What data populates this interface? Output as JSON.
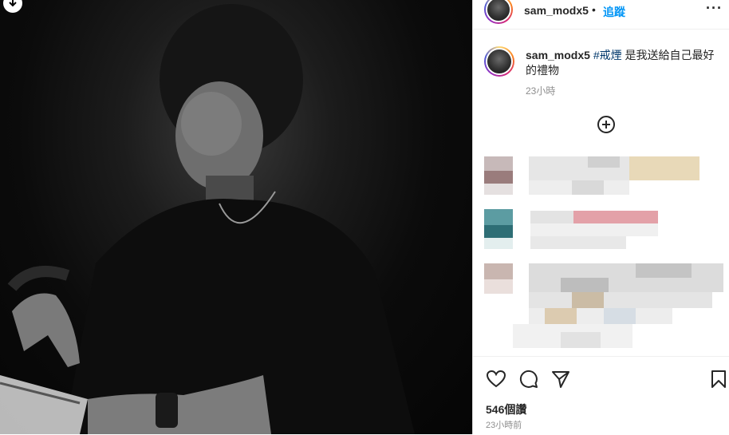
{
  "header": {
    "username": "sam_modx5",
    "separator": "•",
    "follow_label": "追蹤",
    "more_label": "···"
  },
  "post": {
    "caption_user": "sam_modx5",
    "hashtag": "#戒煙",
    "caption_text": " 是我送給自己最好的禮物",
    "age": "23小時"
  },
  "footer": {
    "likes": "546個讚",
    "posted_ago": "23小時前"
  },
  "icons": {
    "download": "download-icon",
    "add": "add-circle-icon",
    "like": "heart-icon",
    "comment": "comment-icon",
    "share": "send-icon",
    "save": "bookmark-icon"
  }
}
